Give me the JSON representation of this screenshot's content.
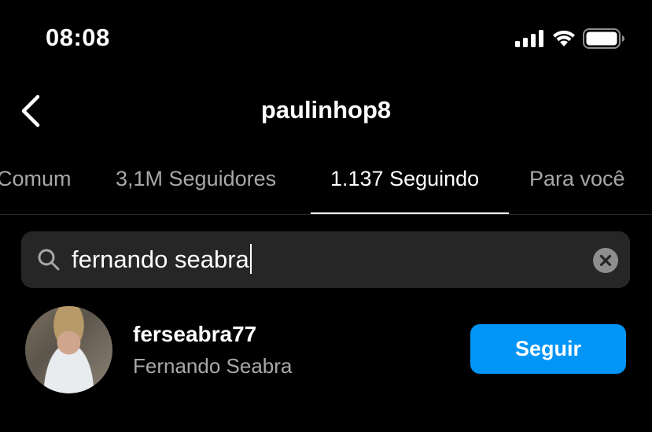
{
  "status_bar": {
    "time": "08:08",
    "icons": [
      "signal-icon",
      "wifi-icon",
      "battery-icon"
    ]
  },
  "header": {
    "title": "paulinhop8",
    "back_icon": "chevron-left-icon"
  },
  "tabs": [
    {
      "label": "Comum",
      "active": false
    },
    {
      "label": "3,1M Seguidores",
      "active": false
    },
    {
      "label": "1.137 Seguindo",
      "active": true
    },
    {
      "label": "Para você",
      "active": false
    }
  ],
  "search": {
    "value": "fernando seabra",
    "icon": "search-icon",
    "clear_icon": "clear-icon"
  },
  "results": [
    {
      "username": "ferseabra77",
      "full_name": "Fernando Seabra",
      "action_label": "Seguir"
    }
  ],
  "colors": {
    "background": "#000000",
    "accent": "#0095f6",
    "secondary_text": "#a8a8a8",
    "search_bg": "#262626"
  }
}
